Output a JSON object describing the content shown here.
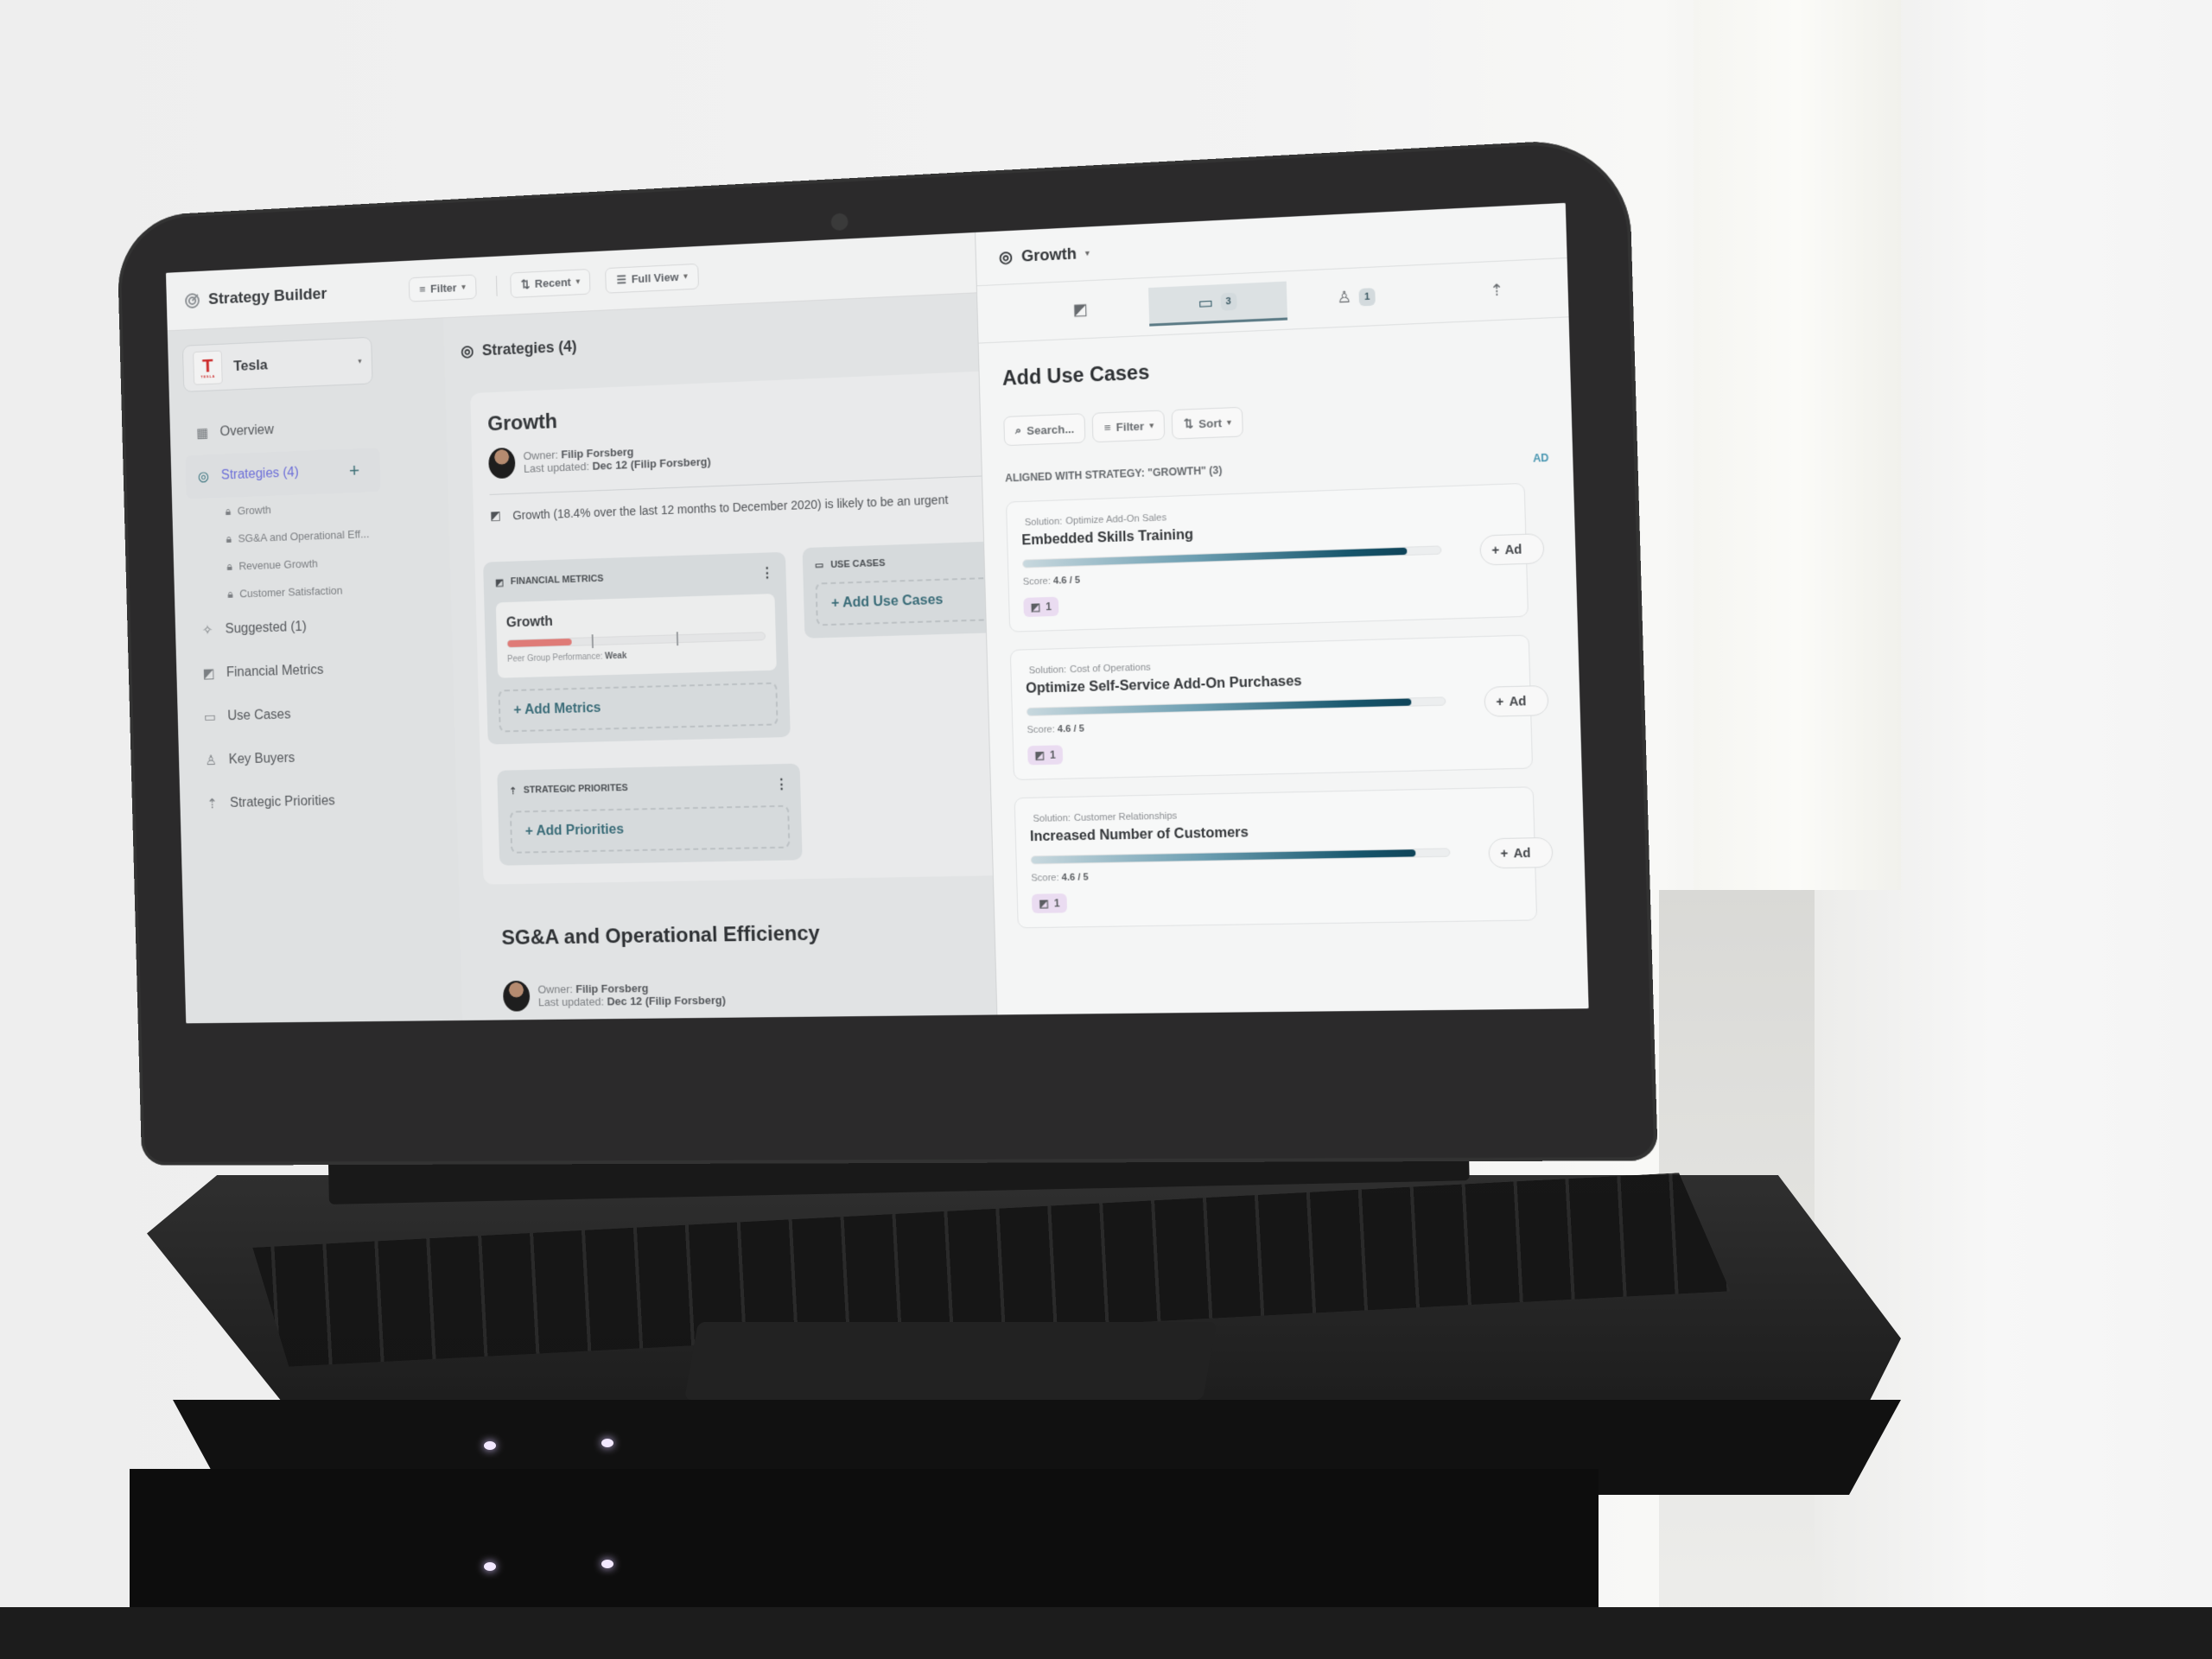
{
  "app": {
    "title": "Strategy Builder",
    "toolbar": {
      "filter_label": "Filter",
      "recent_label": "Recent",
      "view_label": "Full View"
    }
  },
  "sidebar": {
    "company": "Tesla",
    "company_logo_text": "TESLA",
    "items": [
      {
        "label": "Overview",
        "icon": "building-icon"
      },
      {
        "label": "Strategies (4)",
        "icon": "target-icon",
        "active": true
      },
      {
        "label": "Suggested (1)",
        "icon": "sparkles-icon"
      },
      {
        "label": "Financial Metrics",
        "icon": "chart-icon"
      },
      {
        "label": "Use Cases",
        "icon": "briefcase-icon"
      },
      {
        "label": "Key Buyers",
        "icon": "user-icon"
      },
      {
        "label": "Strategic Priorities",
        "icon": "priorities-icon"
      }
    ],
    "strategies": [
      {
        "label": "Growth"
      },
      {
        "label": "SG&A and Operational Eff..."
      },
      {
        "label": "Revenue Growth"
      },
      {
        "label": "Customer Satisfaction"
      }
    ]
  },
  "main": {
    "heading": "Strategies (4)",
    "strategy": {
      "title": "Growth",
      "owner_label": "Owner:",
      "owner": "Filip Forsberg",
      "updated_label": "Last updated:",
      "updated": "Dec 12 (Filip Forsberg)",
      "description": "Growth (18.4% over the last 12 months to December 2020) is likely to be an urgent",
      "financial_metrics": {
        "header": "Financial Metrics",
        "metric_name": "Growth",
        "performance_fraction": 0.25,
        "peer_label": "Peer Group Performance:",
        "peer_value": "Weak",
        "add_label": "+ Add Metrics"
      },
      "use_cases": {
        "header": "Use Cases",
        "add_label": "+ Add Use Cases"
      },
      "strategic_priorities": {
        "header": "Strategic Priorites",
        "add_label": "+ Add Priorities"
      }
    },
    "strategy2": {
      "title": "SG&A and Operational Efficiency",
      "owner_label": "Owner:",
      "owner": "Filip Forsberg",
      "updated_label": "Last updated:",
      "updated": "Dec 12 (Filip Forsberg)"
    }
  },
  "panel": {
    "title": "Growth",
    "tabs": [
      {
        "icon": "chart-icon",
        "badge": ""
      },
      {
        "icon": "briefcase-icon",
        "badge": "3",
        "active": true
      },
      {
        "icon": "user-icon",
        "badge": "1"
      },
      {
        "icon": "priorities-icon",
        "badge": ""
      }
    ],
    "heading": "Add Use Cases",
    "search_placeholder": "Search...",
    "filter_label": "Filter",
    "sort_label": "Sort",
    "aligned_label": "ALIGNED WITH STRATEGY: \"GROWTH\" (3)",
    "add_all_label": "AD",
    "use_cases": [
      {
        "solution_label": "Solution:",
        "solution": "Optimize Add-On Sales",
        "name": "Embedded Skills Training",
        "score": "4.6 / 5",
        "score_fraction": 0.92,
        "tag_count": "1",
        "add_label": "Ad"
      },
      {
        "solution_label": "Solution:",
        "solution": "Cost of Operations",
        "name": "Optimize Self-Service Add-On Purchases",
        "score": "4.6 / 5",
        "score_fraction": 0.92,
        "tag_count": "1",
        "add_label": "Ad"
      },
      {
        "solution_label": "Solution:",
        "solution": "Customer Relationships",
        "name": "Increased Number of Customers",
        "score": "4.6 / 5",
        "score_fraction": 0.92,
        "tag_count": "1",
        "add_label": "Ad"
      }
    ],
    "score_label": "Score:"
  }
}
